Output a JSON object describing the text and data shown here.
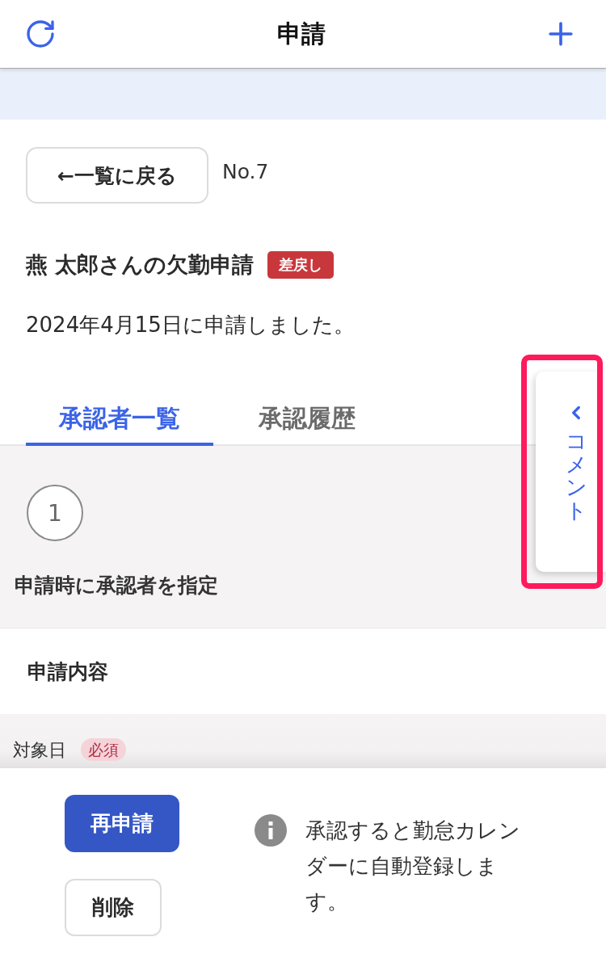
{
  "header": {
    "title": "申請"
  },
  "back_button": "←一覧に戻る",
  "request_number": "No.7",
  "request": {
    "title": "燕 太郎さんの欠勤申請",
    "status_badge": "差戻し",
    "submitted": "2024年4月15日に申請しました。"
  },
  "tabs": [
    {
      "label": "承認者一覧",
      "selected": true
    },
    {
      "label": "承認履歴",
      "selected": false
    }
  ],
  "approval_steps": [
    {
      "number": "1",
      "label": "申請時に承認者を指定"
    }
  ],
  "content_section": {
    "title": "申請内容",
    "fields": [
      {
        "label": "対象日",
        "required_badge": "必須"
      }
    ]
  },
  "comment_tab": {
    "label": "コメント",
    "highlighted": true
  },
  "actions": [
    {
      "label": "再申請",
      "kind": "primary"
    },
    {
      "label": "削除",
      "kind": "secondary"
    }
  ],
  "info_note": "承認すると勤怠カレンダーに自動登録します。"
}
